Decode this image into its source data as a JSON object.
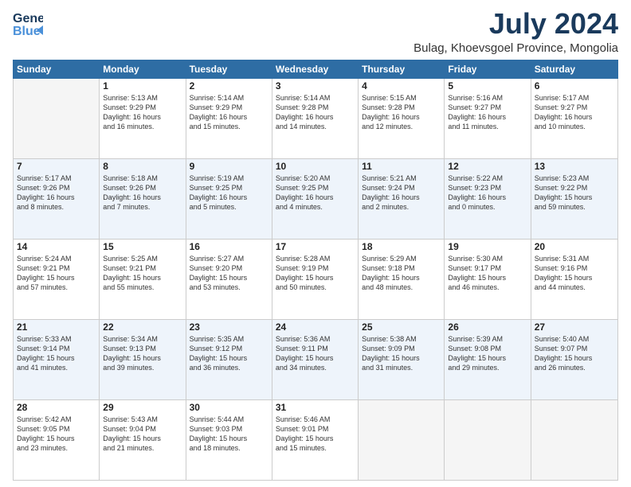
{
  "logo": {
    "line1": "General",
    "line2": "Blue"
  },
  "title": {
    "month": "July 2024",
    "location": "Bulag, Khoevsgoel Province, Mongolia"
  },
  "header_days": [
    "Sunday",
    "Monday",
    "Tuesday",
    "Wednesday",
    "Thursday",
    "Friday",
    "Saturday"
  ],
  "weeks": [
    [
      {
        "day": "",
        "sunrise": "",
        "sunset": "",
        "daylight": ""
      },
      {
        "day": "1",
        "sunrise": "Sunrise: 5:13 AM",
        "sunset": "Sunset: 9:29 PM",
        "daylight": "Daylight: 16 hours and 16 minutes."
      },
      {
        "day": "2",
        "sunrise": "Sunrise: 5:14 AM",
        "sunset": "Sunset: 9:29 PM",
        "daylight": "Daylight: 16 hours and 15 minutes."
      },
      {
        "day": "3",
        "sunrise": "Sunrise: 5:14 AM",
        "sunset": "Sunset: 9:28 PM",
        "daylight": "Daylight: 16 hours and 14 minutes."
      },
      {
        "day": "4",
        "sunrise": "Sunrise: 5:15 AM",
        "sunset": "Sunset: 9:28 PM",
        "daylight": "Daylight: 16 hours and 12 minutes."
      },
      {
        "day": "5",
        "sunrise": "Sunrise: 5:16 AM",
        "sunset": "Sunset: 9:27 PM",
        "daylight": "Daylight: 16 hours and 11 minutes."
      },
      {
        "day": "6",
        "sunrise": "Sunrise: 5:17 AM",
        "sunset": "Sunset: 9:27 PM",
        "daylight": "Daylight: 16 hours and 10 minutes."
      }
    ],
    [
      {
        "day": "7",
        "sunrise": "Sunrise: 5:17 AM",
        "sunset": "Sunset: 9:26 PM",
        "daylight": "Daylight: 16 hours and 8 minutes."
      },
      {
        "day": "8",
        "sunrise": "Sunrise: 5:18 AM",
        "sunset": "Sunset: 9:26 PM",
        "daylight": "Daylight: 16 hours and 7 minutes."
      },
      {
        "day": "9",
        "sunrise": "Sunrise: 5:19 AM",
        "sunset": "Sunset: 9:25 PM",
        "daylight": "Daylight: 16 hours and 5 minutes."
      },
      {
        "day": "10",
        "sunrise": "Sunrise: 5:20 AM",
        "sunset": "Sunset: 9:25 PM",
        "daylight": "Daylight: 16 hours and 4 minutes."
      },
      {
        "day": "11",
        "sunrise": "Sunrise: 5:21 AM",
        "sunset": "Sunset: 9:24 PM",
        "daylight": "Daylight: 16 hours and 2 minutes."
      },
      {
        "day": "12",
        "sunrise": "Sunrise: 5:22 AM",
        "sunset": "Sunset: 9:23 PM",
        "daylight": "Daylight: 16 hours and 0 minutes."
      },
      {
        "day": "13",
        "sunrise": "Sunrise: 5:23 AM",
        "sunset": "Sunset: 9:22 PM",
        "daylight": "Daylight: 15 hours and 59 minutes."
      }
    ],
    [
      {
        "day": "14",
        "sunrise": "Sunrise: 5:24 AM",
        "sunset": "Sunset: 9:21 PM",
        "daylight": "Daylight: 15 hours and 57 minutes."
      },
      {
        "day": "15",
        "sunrise": "Sunrise: 5:25 AM",
        "sunset": "Sunset: 9:21 PM",
        "daylight": "Daylight: 15 hours and 55 minutes."
      },
      {
        "day": "16",
        "sunrise": "Sunrise: 5:27 AM",
        "sunset": "Sunset: 9:20 PM",
        "daylight": "Daylight: 15 hours and 53 minutes."
      },
      {
        "day": "17",
        "sunrise": "Sunrise: 5:28 AM",
        "sunset": "Sunset: 9:19 PM",
        "daylight": "Daylight: 15 hours and 50 minutes."
      },
      {
        "day": "18",
        "sunrise": "Sunrise: 5:29 AM",
        "sunset": "Sunset: 9:18 PM",
        "daylight": "Daylight: 15 hours and 48 minutes."
      },
      {
        "day": "19",
        "sunrise": "Sunrise: 5:30 AM",
        "sunset": "Sunset: 9:17 PM",
        "daylight": "Daylight: 15 hours and 46 minutes."
      },
      {
        "day": "20",
        "sunrise": "Sunrise: 5:31 AM",
        "sunset": "Sunset: 9:16 PM",
        "daylight": "Daylight: 15 hours and 44 minutes."
      }
    ],
    [
      {
        "day": "21",
        "sunrise": "Sunrise: 5:33 AM",
        "sunset": "Sunset: 9:14 PM",
        "daylight": "Daylight: 15 hours and 41 minutes."
      },
      {
        "day": "22",
        "sunrise": "Sunrise: 5:34 AM",
        "sunset": "Sunset: 9:13 PM",
        "daylight": "Daylight: 15 hours and 39 minutes."
      },
      {
        "day": "23",
        "sunrise": "Sunrise: 5:35 AM",
        "sunset": "Sunset: 9:12 PM",
        "daylight": "Daylight: 15 hours and 36 minutes."
      },
      {
        "day": "24",
        "sunrise": "Sunrise: 5:36 AM",
        "sunset": "Sunset: 9:11 PM",
        "daylight": "Daylight: 15 hours and 34 minutes."
      },
      {
        "day": "25",
        "sunrise": "Sunrise: 5:38 AM",
        "sunset": "Sunset: 9:09 PM",
        "daylight": "Daylight: 15 hours and 31 minutes."
      },
      {
        "day": "26",
        "sunrise": "Sunrise: 5:39 AM",
        "sunset": "Sunset: 9:08 PM",
        "daylight": "Daylight: 15 hours and 29 minutes."
      },
      {
        "day": "27",
        "sunrise": "Sunrise: 5:40 AM",
        "sunset": "Sunset: 9:07 PM",
        "daylight": "Daylight: 15 hours and 26 minutes."
      }
    ],
    [
      {
        "day": "28",
        "sunrise": "Sunrise: 5:42 AM",
        "sunset": "Sunset: 9:05 PM",
        "daylight": "Daylight: 15 hours and 23 minutes."
      },
      {
        "day": "29",
        "sunrise": "Sunrise: 5:43 AM",
        "sunset": "Sunset: 9:04 PM",
        "daylight": "Daylight: 15 hours and 21 minutes."
      },
      {
        "day": "30",
        "sunrise": "Sunrise: 5:44 AM",
        "sunset": "Sunset: 9:03 PM",
        "daylight": "Daylight: 15 hours and 18 minutes."
      },
      {
        "day": "31",
        "sunrise": "Sunrise: 5:46 AM",
        "sunset": "Sunset: 9:01 PM",
        "daylight": "Daylight: 15 hours and 15 minutes."
      },
      {
        "day": "",
        "sunrise": "",
        "sunset": "",
        "daylight": ""
      },
      {
        "day": "",
        "sunrise": "",
        "sunset": "",
        "daylight": ""
      },
      {
        "day": "",
        "sunrise": "",
        "sunset": "",
        "daylight": ""
      }
    ]
  ]
}
